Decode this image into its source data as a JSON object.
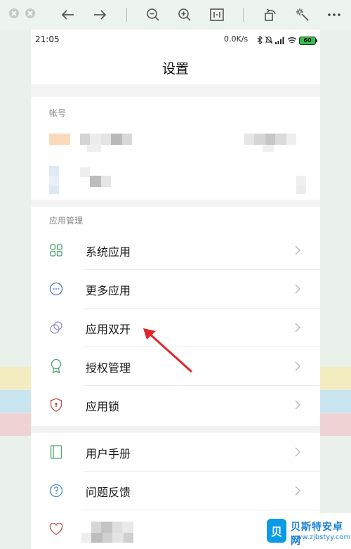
{
  "status_bar": {
    "time": "21:05",
    "net_speed": "0.0K/s",
    "battery": "60",
    "icons": [
      "bluetooth-icon",
      "mute-icon",
      "signal-icon",
      "wifi-icon",
      "battery-icon"
    ]
  },
  "header": {
    "title": "设置"
  },
  "account_section": {
    "title": "帐号"
  },
  "app_section": {
    "title": "应用管理",
    "items": [
      {
        "label": "系统应用",
        "icon": "grid-icon"
      },
      {
        "label": "更多应用",
        "icon": "more-dots-icon"
      },
      {
        "label": "应用双开",
        "icon": "dual-circles-icon"
      },
      {
        "label": "授权管理",
        "icon": "badge-icon"
      },
      {
        "label": "应用锁",
        "icon": "shield-icon"
      }
    ]
  },
  "help_section": {
    "items": [
      {
        "label": "用户手册",
        "icon": "book-icon"
      },
      {
        "label": "问题反馈",
        "icon": "question-icon"
      },
      {
        "label": "",
        "icon": "heart-icon"
      }
    ]
  },
  "watermark": {
    "title": "贝斯特安卓网",
    "url": "www.zjbstyy.com",
    "badge": "贝"
  },
  "colors": {
    "accent_green": "#49a26e",
    "annotation_red": "#e0262b",
    "divider": "#ececec"
  }
}
